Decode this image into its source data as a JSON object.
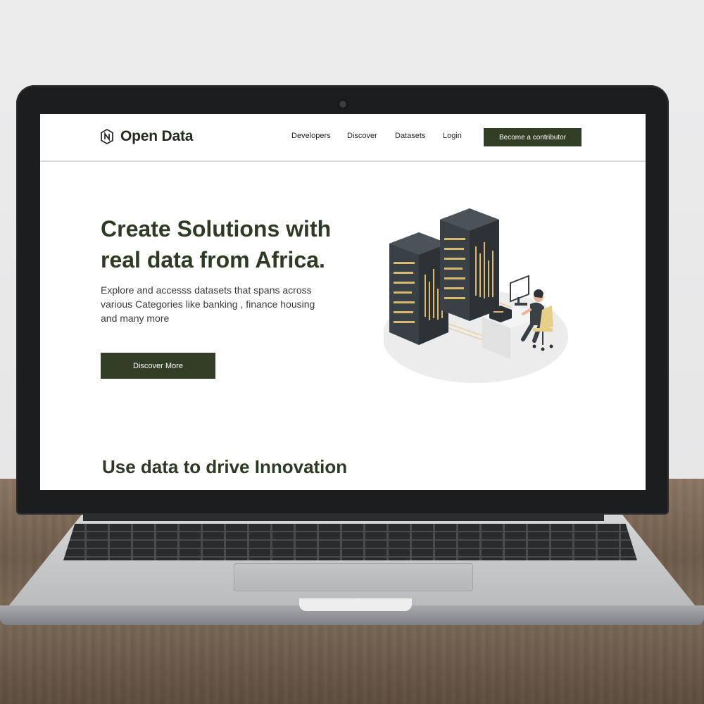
{
  "brand": {
    "name": "Open Data",
    "logo_icon": "hexagon-n-logo-icon"
  },
  "nav": {
    "items": [
      "Developers",
      "Discover",
      "Datasets",
      "Login"
    ],
    "cta_label": "Become a contributor"
  },
  "hero": {
    "title_line1": "Create Solutions with",
    "title_line2": "real data from Africa.",
    "subtitle": "Explore and accesss datasets that spans across various Categories like banking , finance housing and many more",
    "button_label": "Discover More",
    "illustration_icon": "server-rack-illustration-icon"
  },
  "section": {
    "title": "Use data to drive Innovation"
  },
  "colors": {
    "brand_dark": "#313d24",
    "heading": "#2f3a24",
    "accent_gold": "#d9b96b"
  }
}
